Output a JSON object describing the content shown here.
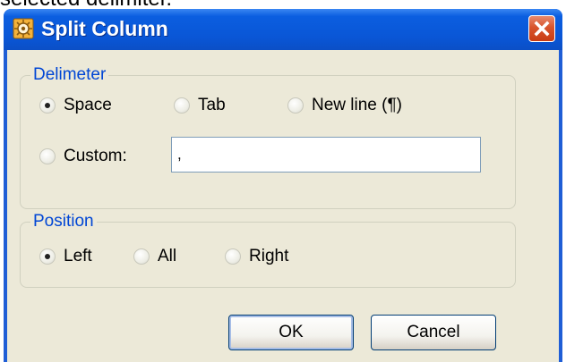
{
  "caption": "selected delimiter.",
  "dialog": {
    "title": "Split Column",
    "delimiter": {
      "legend": "Delimeter",
      "options": [
        "Space",
        "Tab",
        "New line (¶)",
        "Custom:"
      ],
      "selected": "Space",
      "custom_value": ","
    },
    "position": {
      "legend": "Position",
      "options": [
        "Left",
        "All",
        "Right"
      ],
      "selected": "Left"
    },
    "buttons": {
      "ok": "OK",
      "cancel": "Cancel"
    }
  }
}
